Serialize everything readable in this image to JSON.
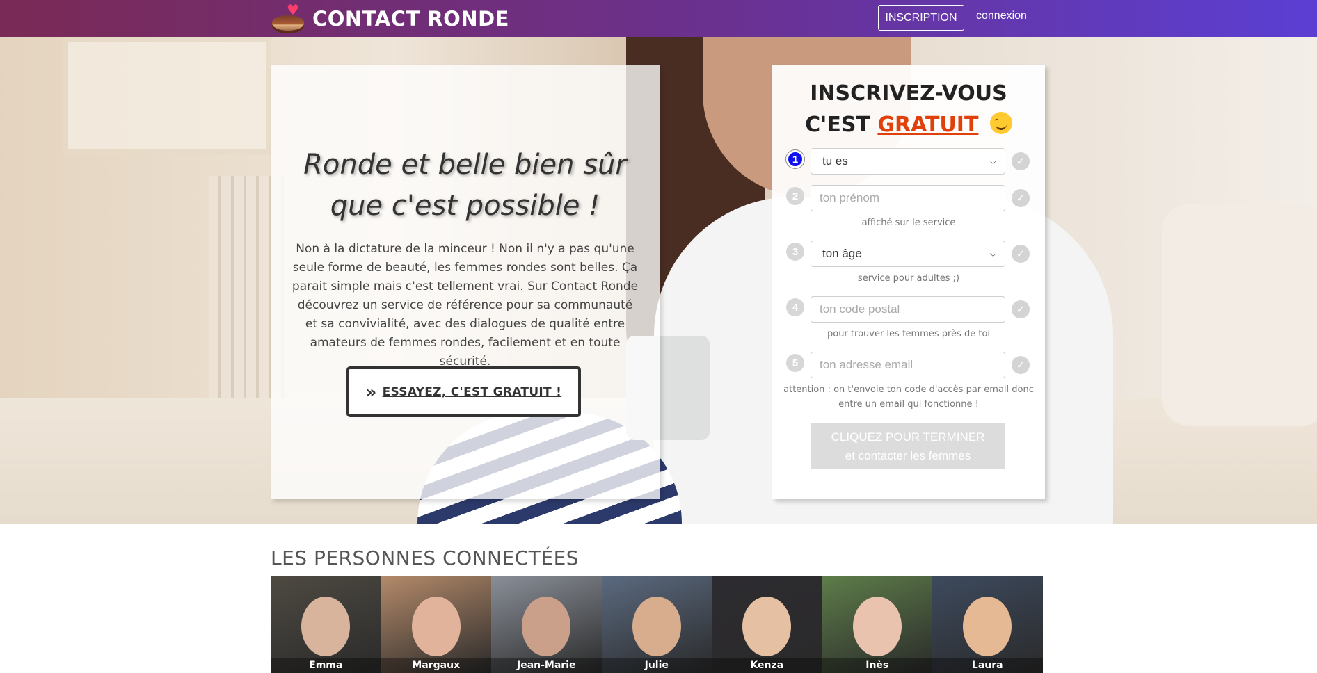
{
  "header": {
    "brand": "CONTACT RONDE",
    "signup_label": "INSCRIPTION",
    "login_label": "connexion"
  },
  "hero": {
    "title_line1": "Ronde et belle bien sûr",
    "title_line2": "que c'est possible !",
    "text": "Non à la dictature de la minceur ! Non il n'y a pas qu'une seule forme de beauté, les femmes rondes sont belles. Ça parait simple mais c'est tellement vrai. Sur Contact Ronde découvrez un service de référence pour sa communauté et sa convivialité, avec des dialogues de qualité entre amateurs de femmes rondes, facilement et en toute sécurité.",
    "cta_label": "ESSAYEZ, C'EST GRATUIT !"
  },
  "signup": {
    "title_line1": "INSCRIVEZ-VOUS",
    "title_prefix": "C'EST ",
    "title_free": "GRATUIT",
    "steps": [
      {
        "num": "1",
        "value": "tu es",
        "kind": "select",
        "hint": ""
      },
      {
        "num": "2",
        "value": "ton prénom",
        "kind": "input",
        "hint": "affiché sur le service"
      },
      {
        "num": "3",
        "value": "ton âge",
        "kind": "select",
        "hint": "service pour adultes ;)"
      },
      {
        "num": "4",
        "value": "ton code postal",
        "kind": "input",
        "hint": "pour trouver les femmes près de toi"
      },
      {
        "num": "5",
        "value": "ton adresse email",
        "kind": "input",
        "hint": "attention : on t'envoie ton code d'accès par email donc entre un email qui fonctionne !"
      }
    ],
    "submit_line1": "CLIQUEZ POUR TERMINER",
    "submit_line2": "et contacter les femmes"
  },
  "connected": {
    "title": "LES PERSONNES CONNECTÉES",
    "people": [
      {
        "name": "Emma",
        "bg": "#4e4a42",
        "skin": "#d9b49c"
      },
      {
        "name": "Margaux",
        "bg": "#b48a6a",
        "skin": "#e2b39b"
      },
      {
        "name": "Jean-Marie",
        "bg": "#8a8f98",
        "skin": "#caa08a"
      },
      {
        "name": "Julie",
        "bg": "#5b6a80",
        "skin": "#d8ad8e"
      },
      {
        "name": "Kenza",
        "bg": "#2d2b30",
        "skin": "#e5c0a2"
      },
      {
        "name": "Inès",
        "bg": "#5e7d4a",
        "skin": "#e9c3ad"
      },
      {
        "name": "Laura",
        "bg": "#3d4a5e",
        "skin": "#e4b994"
      }
    ]
  },
  "colors": {
    "header_start": "#7a2a55",
    "header_end": "#5b3fd3",
    "accent_free": "#e0400a",
    "step_active": "#1010ee"
  }
}
